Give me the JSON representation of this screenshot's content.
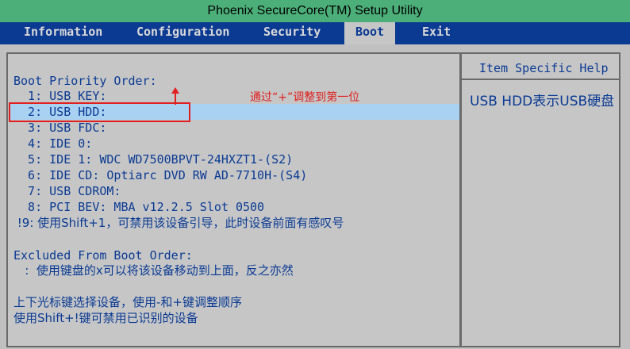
{
  "title": "Phoenix SecureCore(TM) Setup Utility",
  "tabs": [
    {
      "label": "Information"
    },
    {
      "label": "Configuration"
    },
    {
      "label": "Security"
    },
    {
      "label": "Boot"
    },
    {
      "label": "Exit"
    }
  ],
  "active_tab": "Boot",
  "boot": {
    "header": "Boot Priority Order:",
    "items": [
      "  1: USB KEY:",
      "  2: USB HDD:",
      "  3: USB FDC:",
      "  4: IDE 0:",
      "  5: IDE 1: WDC WD7500BPVT-24HXZT1-(S2)",
      "  6: IDE CD: Optiarc DVD RW AD-7710H-(S4)",
      "  7: USB CDROM:",
      "  8: PCI BEV: MBA v12.2.5 Slot 0500",
      " !9: 使用Shift+1，可禁用该设备引导，此时设备前面有感叹号"
    ],
    "excluded_header": "Excluded From Boot Order:",
    "excluded_note": "   :  使用键盘的x可以将该设备移动到上面，反之亦然",
    "footer_line1": "上下光标键选择设备，使用-和+键调整顺序",
    "footer_line2": "使用Shift+!键可禁用已识别的设备"
  },
  "annotation": "通过“+”调整到第一位",
  "help": {
    "title": "Item Specific Help",
    "text": "USB  HDD表示USB硬盘"
  },
  "colors": {
    "titlebar": "#4caf79",
    "menubar": "#0b3a93",
    "panel": "#c6c6c6",
    "text": "#0b3a93",
    "highlight": "#a9d1f2",
    "annotation": "#e02020"
  }
}
